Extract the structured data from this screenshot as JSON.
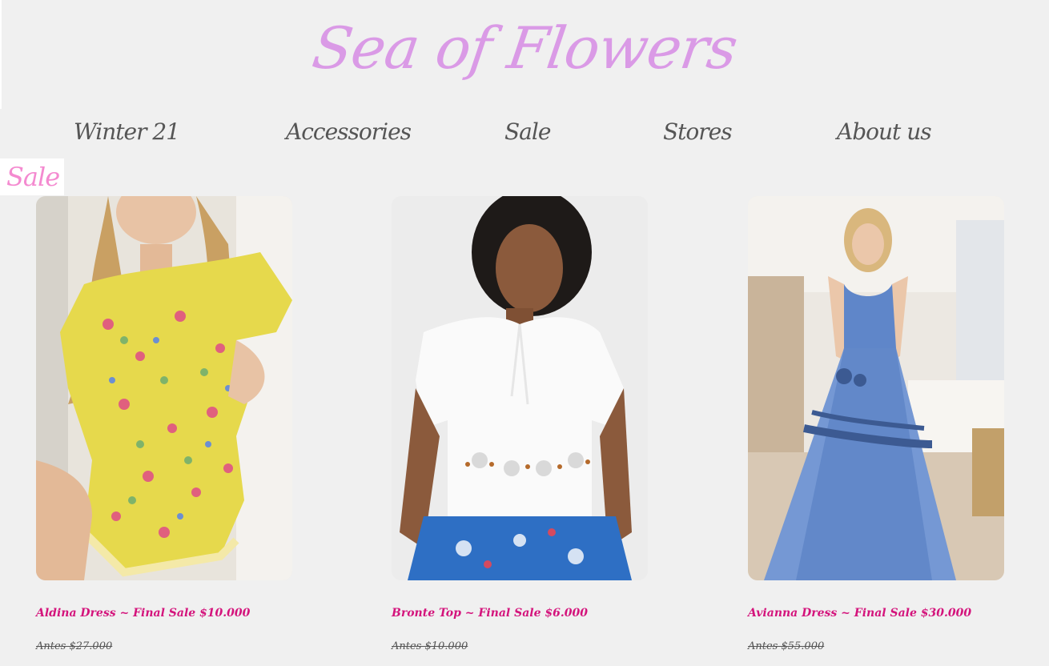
{
  "logo": {
    "text": "Sea of Flowers"
  },
  "nav": {
    "items": [
      {
        "label": "Winter 21"
      },
      {
        "label": "Accessories"
      },
      {
        "label": "Sale"
      },
      {
        "label": "Stores"
      },
      {
        "label": "About us"
      }
    ]
  },
  "section": {
    "title": "Sale"
  },
  "products": [
    {
      "name": "Aldina Dress ~ Final Sale $10.000",
      "old_price": "Antes $27.000",
      "image": "woman in yellow floral mini dress"
    },
    {
      "name": "Bronte Top ~ Final Sale $6.000",
      "old_price": "Antes $10.000",
      "image": "woman in white eyelet blouse and blue skirt"
    },
    {
      "name": "Avianna Dress ~ Final Sale $30.000",
      "old_price": "Antes $55.000",
      "image": "woman in blue tulle gown"
    }
  ],
  "colors": {
    "background": "#f0f0f0",
    "logo": "#da9ae6",
    "nav_text": "#555555",
    "section_title": "#f48ad0",
    "product_title": "#d4147c"
  }
}
